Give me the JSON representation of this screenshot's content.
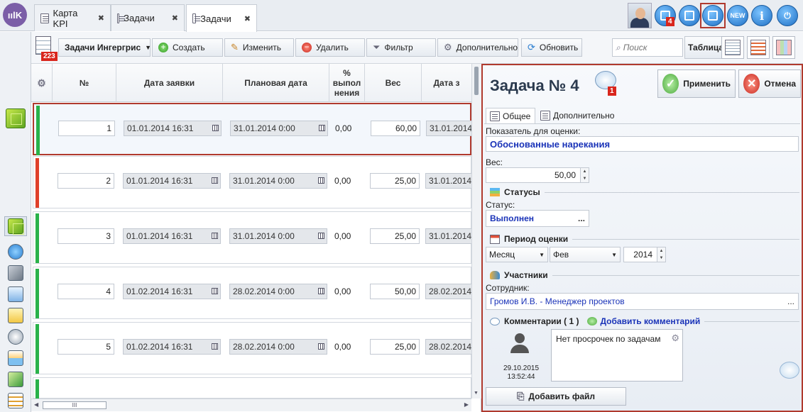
{
  "app": {
    "logo_text": "ıılK"
  },
  "tabs": [
    {
      "label": "Карта KPI",
      "close": "✖"
    },
    {
      "label": "Задачи",
      "close": "✖"
    },
    {
      "label": "Задачи",
      "close": "✖"
    }
  ],
  "top_icons": {
    "notify_count": "4",
    "new_label": "NEW",
    "info_label": "i"
  },
  "toolbar": {
    "count_badge": "223",
    "selector": "Задачи Ингергрис",
    "create": "Создать",
    "edit": "Изменить",
    "delete": "Удалить",
    "filter": "Фильтр",
    "extra": "Дополнительно",
    "refresh": "Обновить",
    "search_placeholder": "Поиск",
    "table": "Таблица"
  },
  "grid": {
    "headers": {
      "num": "№",
      "request_date": "Дата заявки",
      "plan_date": "Плановая дата",
      "percent": "% выпол нения",
      "weight": "Вес",
      "date_cut": "Дата з"
    },
    "rows": [
      {
        "num": "1",
        "request_date": "01.01.2014 16:31",
        "plan_date": "31.01.2014 0:00",
        "percent": "0,00",
        "weight": "60,00",
        "date": "31.01.2014",
        "color": "#2ab24a"
      },
      {
        "num": "2",
        "request_date": "01.01.2014 16:31",
        "plan_date": "31.01.2014 0:00",
        "percent": "0,00",
        "weight": "25,00",
        "date": "31.01.2014",
        "color": "#e0402a"
      },
      {
        "num": "3",
        "request_date": "01.01.2014 16:31",
        "plan_date": "31.01.2014 0:00",
        "percent": "0,00",
        "weight": "25,00",
        "date": "31.01.2014",
        "color": "#2ab24a"
      },
      {
        "num": "4",
        "request_date": "01.02.2014 16:31",
        "plan_date": "28.02.2014 0:00",
        "percent": "0,00",
        "weight": "50,00",
        "date": "28.02.2014",
        "color": "#2ab24a"
      },
      {
        "num": "5",
        "request_date": "01.02.2014 16:31",
        "plan_date": "28.02.2014 0:00",
        "percent": "0,00",
        "weight": "25,00",
        "date": "28.02.2014",
        "color": "#2ab24a"
      }
    ],
    "scroll_grip": "III"
  },
  "panel": {
    "title": "Задача № 4",
    "comment_badge": "1",
    "apply": "Применить",
    "cancel": "Отмена",
    "tab_general": "Общее",
    "tab_extra": "Дополнительно",
    "indicator_label": "Показатель для оценки:",
    "indicator_value": "Обоснованные нарекания",
    "weight_label": "Вес:",
    "weight_value": "50,00",
    "statuses_section": "Статусы",
    "status_label": "Статус:",
    "status_value": "Выполнен",
    "ellipsis": "...",
    "period_section": "Период оценки",
    "period_type": "Месяц",
    "period_month": "Фев",
    "period_year": "2014",
    "participants_section": "Участники",
    "employee_label": "Сотрудник:",
    "employee_value": "Громов И.В. - Менеджер проектов",
    "comments_section": "Комментарии ( 1 )",
    "add_comment": "Добавить комментарий",
    "comment_text": "Нет просрочек по задачам",
    "comment_date": "29.10.2015",
    "comment_time": "13:52:44",
    "add_file": "Добавить файл"
  }
}
